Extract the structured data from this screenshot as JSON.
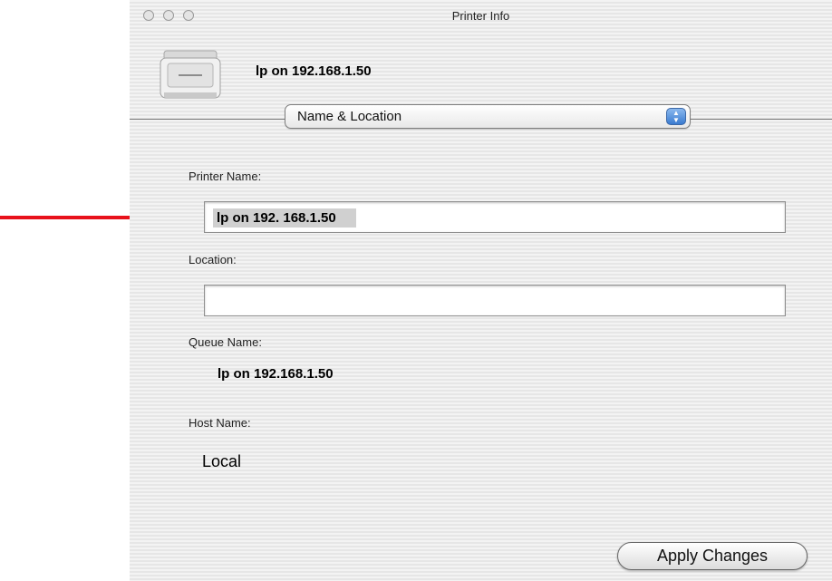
{
  "window": {
    "title": "Printer Info"
  },
  "header": {
    "printer_name": "lp on 192.168.1.50"
  },
  "popup": {
    "selected": "Name & Location"
  },
  "fields": {
    "printer_name_label": "Printer Name:",
    "printer_name_value": "lp on 192. 168.1.50",
    "location_label": "Location:",
    "location_value": "",
    "queue_name_label": "Queue Name:",
    "queue_name_value": "lp on 192.168.1.50",
    "host_name_label": "Host Name:",
    "host_name_value": "Local"
  },
  "buttons": {
    "apply_label": "Apply Changes"
  },
  "colors": {
    "annotation_arrow": "#e8121b"
  }
}
